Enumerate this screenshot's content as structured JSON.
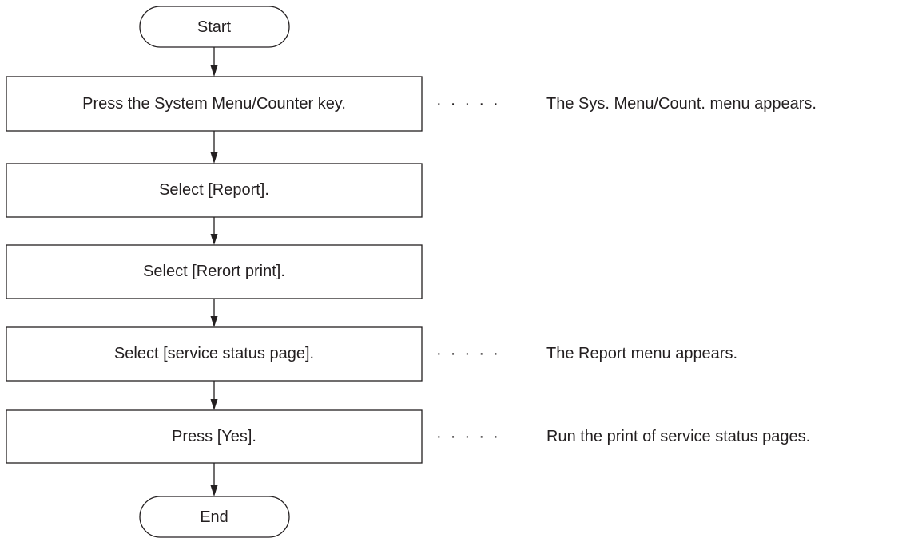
{
  "flow": {
    "start_label": "Start",
    "end_label": "End",
    "steps": [
      {
        "label": "Press the System Menu/Counter key.",
        "note": "The Sys. Menu/Count. menu appears."
      },
      {
        "label": "Select [Report].",
        "note": ""
      },
      {
        "label": "Select [Rerort print].",
        "note": ""
      },
      {
        "label": "Select [service status page].",
        "note": "The Report menu appears."
      },
      {
        "label": "Press [Yes].",
        "note": "Run the print of service status pages."
      }
    ],
    "leader_dots": "·  ·  ·  ·  ·"
  },
  "colors": {
    "line": "#231f20",
    "text": "#231f20",
    "background": "#ffffff"
  }
}
